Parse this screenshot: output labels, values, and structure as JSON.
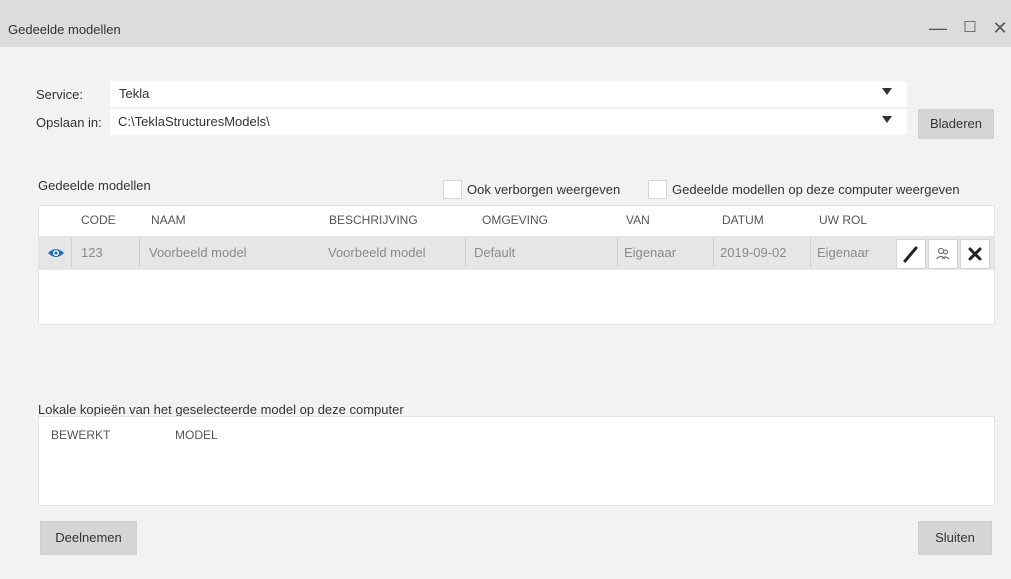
{
  "window": {
    "title": "Gedeelde modellen",
    "controls": {
      "minimize": "—",
      "maximize": "☐",
      "close": "✕"
    }
  },
  "service": {
    "label": "Service:",
    "value": "Tekla"
  },
  "storage": {
    "label": "Opslaan in:",
    "value": "C:\\TeklaStructuresModels\\",
    "browse_label": "Bladeren"
  },
  "shared": {
    "section_label": "Gedeelde modellen",
    "show_hidden_label": "Ook verborgen weergeven",
    "show_local_label": "Gedeelde modellen op deze computer weergeven",
    "columns": [
      "CODE",
      "NAAM",
      "BESCHRIJVING",
      "OMGEVING",
      "VAN",
      "DATUM",
      "UW ROL"
    ],
    "rows": [
      {
        "code": "123",
        "naam": "Voorbeeld model",
        "beschrijving": "Voorbeeld model",
        "omgeving": "Default",
        "van": "Eigenaar",
        "datum": "2019-09-02",
        "rol": "Eigenaar",
        "icons": [
          "eye-icon",
          "pencil-icon",
          "users-icon",
          "close-icon"
        ]
      }
    ]
  },
  "local_copies": {
    "section_label": "Lokale kopieën van het geselecteerde model op deze computer",
    "columns": [
      "BEWERKT",
      "MODEL"
    ]
  },
  "footer": {
    "join_label": "Deelnemen",
    "close_label": "Sluiten"
  },
  "colors": {
    "accent": "#1f6fb8",
    "window_bg": "#f2f2f2",
    "titlebar_bg": "#dcdcdc",
    "row_bg": "#e6e6e6"
  }
}
